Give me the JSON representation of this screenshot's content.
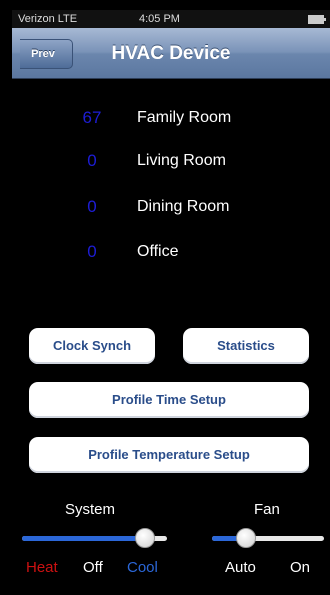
{
  "status": {
    "carrier": "Verizon LTE",
    "time": "4:05 PM"
  },
  "nav": {
    "back_label": "Prev",
    "title": "HVAC Device"
  },
  "rooms": [
    {
      "temp": "67",
      "name": "Family Room"
    },
    {
      "temp": "0",
      "name": "Living Room"
    },
    {
      "temp": "0",
      "name": "Dining Room"
    },
    {
      "temp": "0",
      "name": "Office"
    }
  ],
  "buttons": {
    "clock_synch": "Clock Synch",
    "statistics": "Statistics",
    "profile_time": "Profile Time Setup",
    "profile_temp": "Profile Temperature Setup"
  },
  "system": {
    "label": "System",
    "options": [
      "Heat",
      "Off",
      "Cool"
    ],
    "value": 0.85
  },
  "fan": {
    "label": "Fan",
    "options": [
      "Auto",
      "On"
    ],
    "value": 0.3
  },
  "colors": {
    "temp_text": "#1d1dd6",
    "heat": "#cc1111",
    "cool": "#2b67d8",
    "button_text": "#2a4d8a"
  }
}
